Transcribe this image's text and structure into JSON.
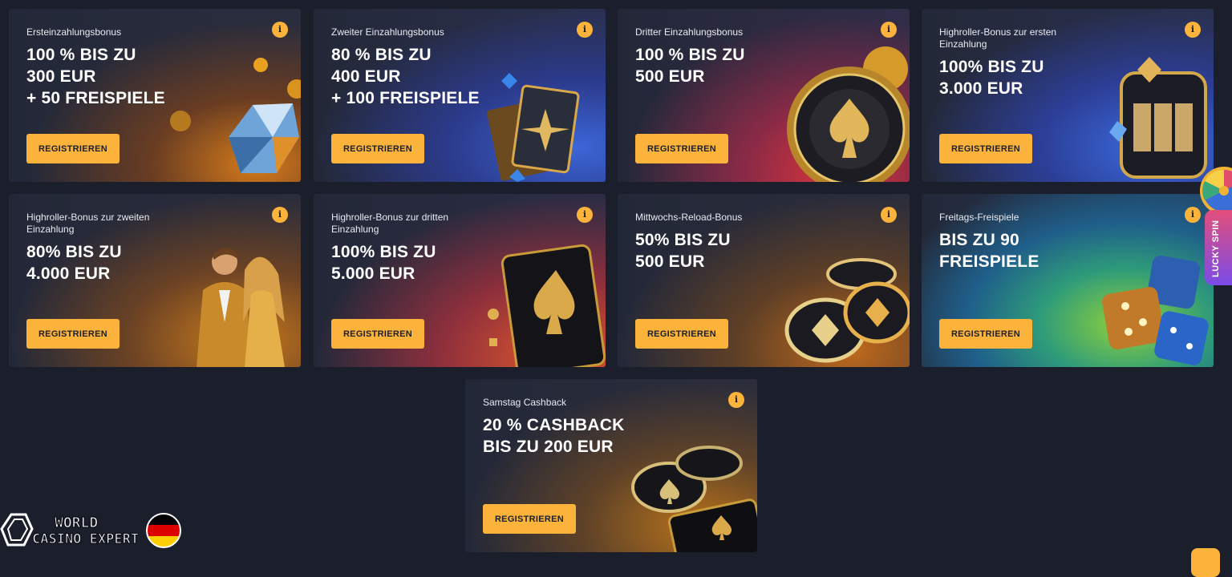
{
  "cards": [
    {
      "subtitle": "Ersteinzahlungsbonus",
      "headline": "100 % BIS ZU\n300 EUR\n+ 50 FREISPIELE",
      "button": "REGISTRIEREN",
      "info": "i"
    },
    {
      "subtitle": "Zweiter Einzahlungsbonus",
      "headline": "80 % BIS ZU\n400 EUR\n+ 100 FREISPIELE",
      "button": "REGISTRIEREN",
      "info": "i"
    },
    {
      "subtitle": "Dritter Einzahlungsbonus",
      "headline": "100 % BIS ZU\n500 EUR",
      "button": "REGISTRIEREN",
      "info": "i"
    },
    {
      "subtitle": "Highroller-Bonus zur ersten Einzahlung",
      "headline": "100% BIS ZU\n3.000 EUR",
      "button": "REGISTRIEREN",
      "info": "i"
    },
    {
      "subtitle": "Highroller-Bonus zur zweiten Einzahlung",
      "headline": "80% BIS ZU\n4.000 EUR",
      "button": "REGISTRIEREN",
      "info": "i"
    },
    {
      "subtitle": "Highroller-Bonus zur dritten Einzahlung",
      "headline": "100% BIS ZU\n5.000 EUR",
      "button": "REGISTRIEREN",
      "info": "i"
    },
    {
      "subtitle": "Mittwochs-Reload-Bonus",
      "headline": "50% BIS ZU\n500 EUR",
      "button": "REGISTRIEREN",
      "info": "i"
    },
    {
      "subtitle": "Freitags-Freispiele",
      "headline": "BIS ZU 90\nFREISPIELE",
      "button": "REGISTRIEREN",
      "info": "i"
    },
    {
      "subtitle": "Samstag Cashback",
      "headline": "20 % CASHBACK\nBIS ZU 200 EUR",
      "button": "REGISTRIEREN",
      "info": "i"
    }
  ],
  "side_widget": {
    "label": "LUCKY SPIN"
  },
  "watermark": {
    "line1": "WORLD",
    "line2": "CASINO EXPERT",
    "flag": "germany-flag-icon"
  },
  "colors": {
    "accent": "#fbb33b",
    "background": "#1b1f2c",
    "text_dark": "#1b1f2c"
  }
}
